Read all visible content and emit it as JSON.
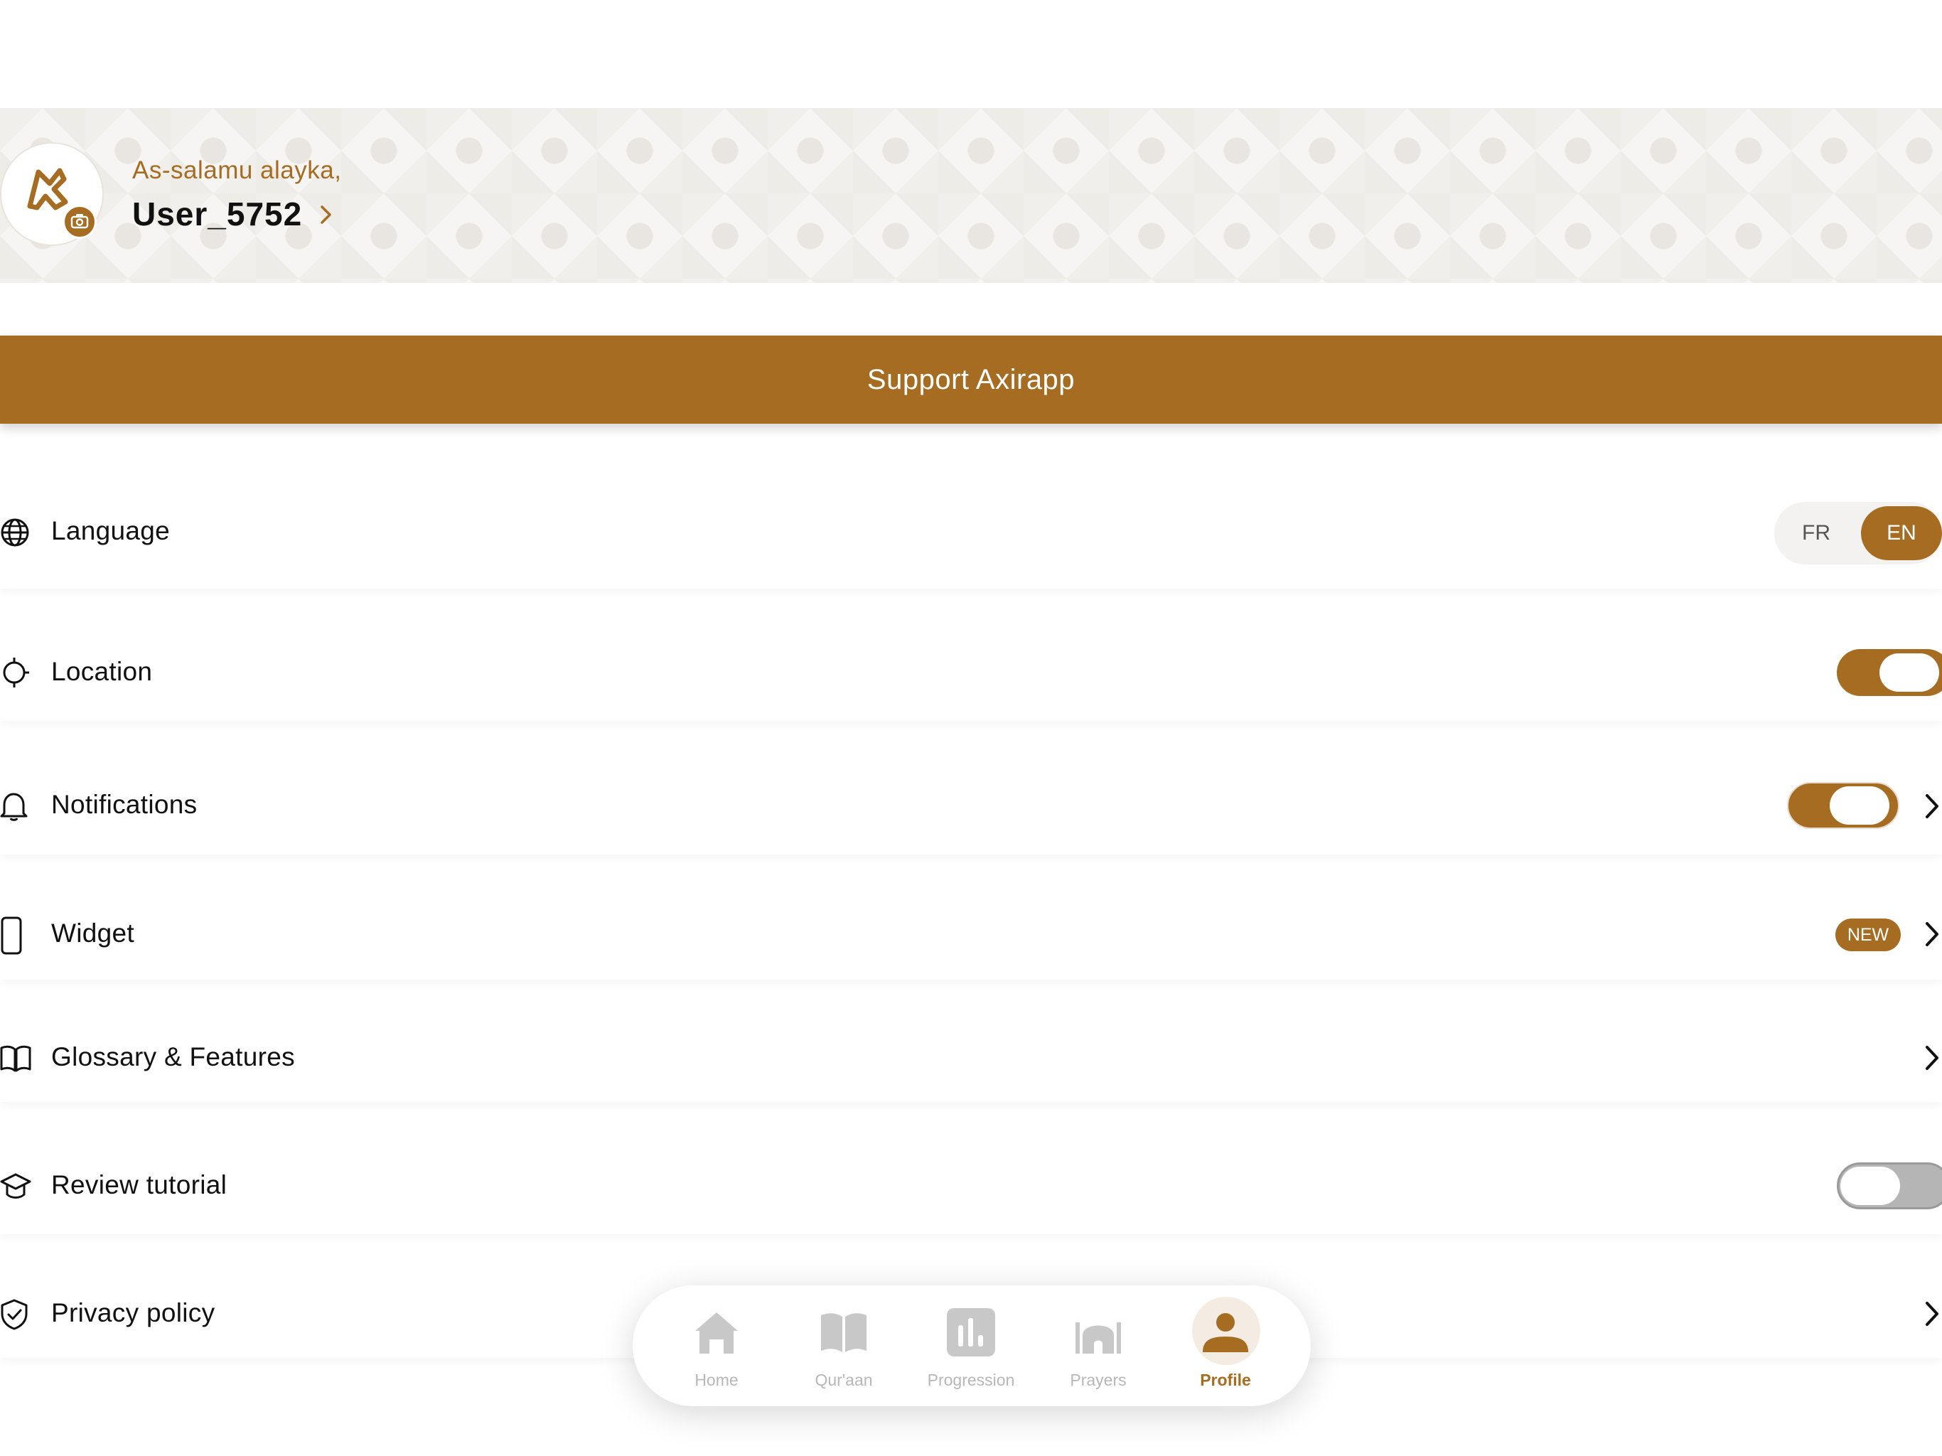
{
  "profile": {
    "greeting": "As-salamu alayka,",
    "username": "User_5752"
  },
  "support_label": "Support Axirapp",
  "settings": {
    "language": {
      "label": "Language",
      "options": [
        "FR",
        "EN"
      ],
      "selected": "EN"
    },
    "location": {
      "label": "Location",
      "enabled": true
    },
    "notifications": {
      "label": "Notifications",
      "enabled": true
    },
    "widget": {
      "label": "Widget",
      "badge": "NEW"
    },
    "glossary": {
      "label": "Glossary & Features"
    },
    "tutorial": {
      "label": "Review tutorial",
      "enabled": false
    },
    "privacy": {
      "label": "Privacy policy"
    }
  },
  "tabbar": {
    "home": "Home",
    "quran": "Qur'aan",
    "progression": "Progression",
    "prayers": "Prayers",
    "profile": "Profile",
    "active": "profile"
  },
  "colors": {
    "accent": "#a66d22",
    "inactive": "#b7b7b7",
    "header_bg": "#f6f5f3"
  }
}
